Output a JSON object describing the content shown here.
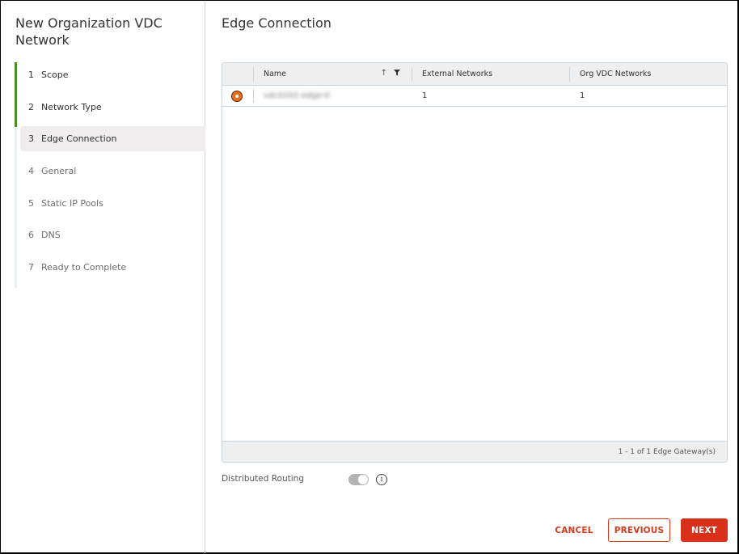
{
  "wizard": {
    "title": "New Organization VDC Network",
    "steps": [
      {
        "number": "1",
        "label": "Scope",
        "state": "done"
      },
      {
        "number": "2",
        "label": "Network Type",
        "state": "done"
      },
      {
        "number": "3",
        "label": "Edge Connection",
        "state": "active"
      },
      {
        "number": "4",
        "label": "General",
        "state": "pending"
      },
      {
        "number": "5",
        "label": "Static IP Pools",
        "state": "pending"
      },
      {
        "number": "6",
        "label": "DNS",
        "state": "pending"
      },
      {
        "number": "7",
        "label": "Ready to Complete",
        "state": "pending"
      }
    ]
  },
  "page": {
    "title": "Edge Connection"
  },
  "grid": {
    "columns": {
      "name": "Name",
      "external_networks": "External Networks",
      "org_vdc_networks": "Org VDC Networks"
    },
    "sort_icon": "arrow-up-icon",
    "filter_icon": "filter-icon",
    "rows": [
      {
        "selected": true,
        "name": "vdc0202-edge-0",
        "external_networks": "1",
        "org_vdc_networks": "1"
      }
    ],
    "footer": "1 - 1 of 1 Edge Gateway(s)"
  },
  "distributed_routing": {
    "label": "Distributed Routing",
    "enabled": true,
    "disabled": true,
    "info_icon": "i"
  },
  "buttons": {
    "cancel": "CANCEL",
    "previous": "PREVIOUS",
    "next": "NEXT"
  },
  "colors": {
    "accent": "#d9301a",
    "step_done": "#4c8d1f",
    "radio_selected": "#e86e1c"
  }
}
